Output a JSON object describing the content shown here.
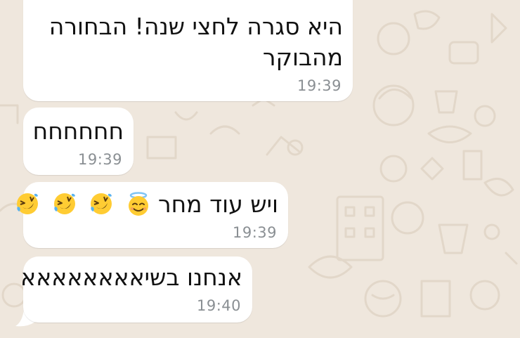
{
  "chat": {
    "messages": [
      {
        "lines": [
          "היא סגרה לחצי שנה! הבחורה",
          "מהבוקר"
        ],
        "time": "19:39"
      },
      {
        "text": "חחחחחח",
        "time": "19:39"
      },
      {
        "text": "ויש עוד מחר",
        "emojis": [
          "smiling-face-with-halo",
          "rolling-on-the-floor-laughing",
          "rolling-on-the-floor-laughing",
          "rolling-on-the-floor-laughing"
        ],
        "time": "19:39"
      },
      {
        "text": "אנחנו בשיאאאאאאאא",
        "time": "19:40"
      }
    ]
  },
  "colors": {
    "wallpaper": "#efe7dd",
    "bubble": "#ffffff",
    "text": "#111111",
    "timestamp": "#8a8f93"
  }
}
